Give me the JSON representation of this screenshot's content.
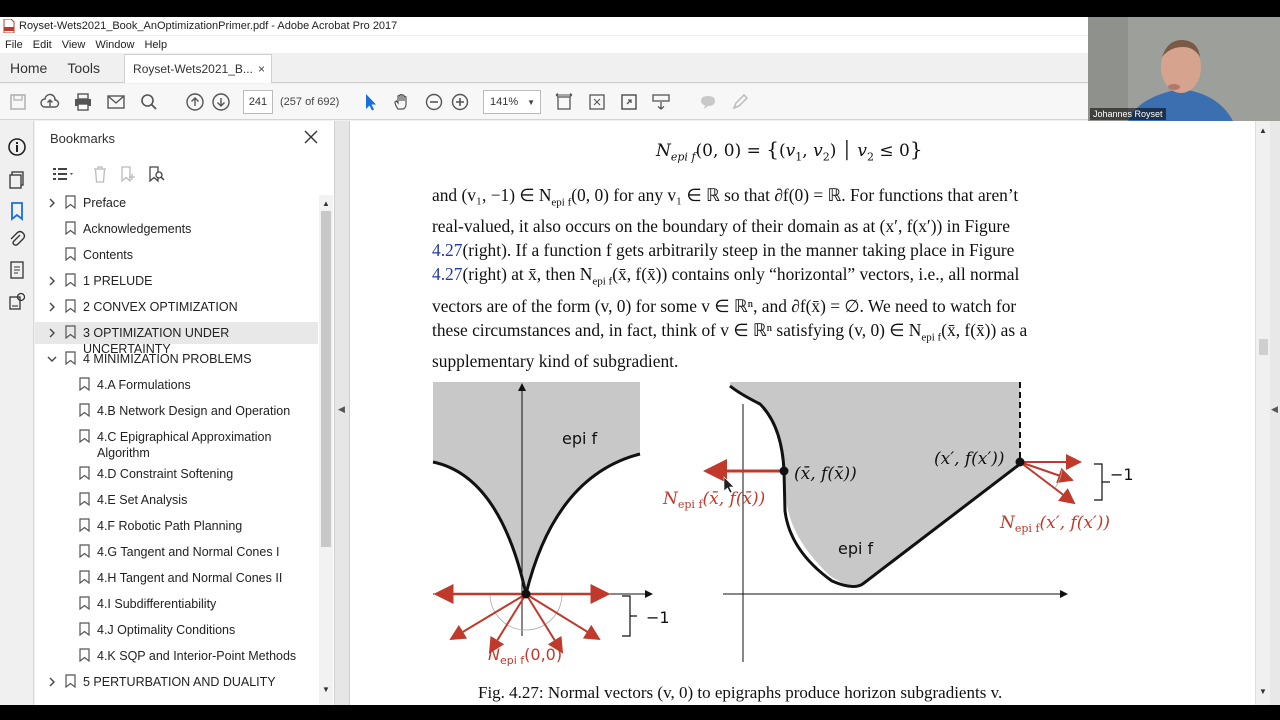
{
  "window": {
    "title": "Royset-Wets2021_Book_AnOptimizationPrimer.pdf - Adobe Acrobat Pro 2017"
  },
  "menubar": {
    "items": [
      "File",
      "Edit",
      "View",
      "Window",
      "Help"
    ]
  },
  "tabs": {
    "home": "Home",
    "tools": "Tools",
    "document": "Royset-Wets2021_B...",
    "close": "×"
  },
  "toolbar": {
    "page_number": "241",
    "page_count": "(257 of 692)",
    "zoom": "141%"
  },
  "bookmarks": {
    "title": "Bookmarks",
    "items": [
      {
        "label": "Preface",
        "expandable": true
      },
      {
        "label": "Acknowledgements",
        "expandable": false
      },
      {
        "label": "Contents",
        "expandable": false
      },
      {
        "label": "1 PRELUDE",
        "expandable": true
      },
      {
        "label": "2 CONVEX OPTIMIZATION",
        "expandable": true
      },
      {
        "label": "3 OPTIMIZATION UNDER UNCERTAINTY",
        "expandable": true,
        "selected": true
      },
      {
        "label": "4 MINIMIZATION PROBLEMS",
        "expanded": true
      },
      {
        "label": "4.A Formulations",
        "child": true
      },
      {
        "label": "4.B Network Design and Operation",
        "child": true
      },
      {
        "label": "4.C Epigraphical Approximation",
        "label2": "Algorithm",
        "child": true
      },
      {
        "label": "4.D Constraint Softening",
        "child": true
      },
      {
        "label": "4.E Set Analysis",
        "child": true
      },
      {
        "label": "4.F Robotic Path Planning",
        "child": true
      },
      {
        "label": "4.G Tangent and Normal Cones I",
        "child": true
      },
      {
        "label": "4.H Tangent and Normal Cones II",
        "child": true
      },
      {
        "label": "4.I Subdifferentiability",
        "child": true
      },
      {
        "label": "4.J Optimality Conditions",
        "child": true
      },
      {
        "label": "4.K SQP and Interior-Point Methods",
        "child": true
      },
      {
        "label": "5 PERTURBATION AND DUALITY",
        "expandable": true
      }
    ]
  },
  "document": {
    "equation": "N_epi f(0, 0) = {(v1, v2) | v2 ≤ 0}",
    "paragraph": {
      "l1": "and (v₁, −1) ∈ N",
      "l1b": "epi f",
      "l1c": "(0, 0) for any v₁ ∈ ℝ so that ∂f(0) = ℝ. For functions that aren’t",
      "l2": "real-valued, it also occurs on the boundary of their domain as at (x′, f(x′)) in Figure",
      "l3a": "4.27",
      "l3b": "(right). If a function f gets arbitrarily steep in the manner taking place in Figure",
      "l4a": "4.27",
      "l4b": "(right) at x̄, then N",
      "l4c": "epi f",
      "l4d": "(x̄, f(x̄)) contains only “horizontal” vectors, i.e., all normal",
      "l5": "vectors are of the form (v, 0) for some v ∈ ℝⁿ, and ∂f(x̄) = ∅. We need to watch for",
      "l6a": "these circumstances and, in fact, think of v ∈ ℝⁿ satisfying (v, 0) ∈ N",
      "l6b": "epi f",
      "l6c": "(x̄, f(x̄)) as a",
      "l7": "supplementary kind of subgradient."
    },
    "figure": {
      "left_epi_label": "epi f",
      "left_normal_label": "N",
      "left_normal_sub": "epi f",
      "left_normal_arg": "(0,0)",
      "left_minus_one": "−1",
      "right_epi_label": "epi f",
      "right_point_xbar": "(x̄, f(x̄))",
      "right_point_xprime": "(x′, f(x′))",
      "right_normal_xbar_sub": "epi f",
      "right_normal_xbar_arg": "(x̄, f(x̄))",
      "right_normal_xprime_sub": "epi f",
      "right_normal_xprime_arg": "(x′, f(x′))",
      "right_minus_one": "−1",
      "caption": "Fig. 4.27: Normal vectors (v, 0) to epigraphs produce horizon subgradients v."
    }
  },
  "webcam": {
    "name": "Johannes Royset"
  },
  "colors": {
    "accent_red": "#c0392b",
    "link_blue": "#2238a8",
    "epi_gray": "#c8c8c8"
  }
}
